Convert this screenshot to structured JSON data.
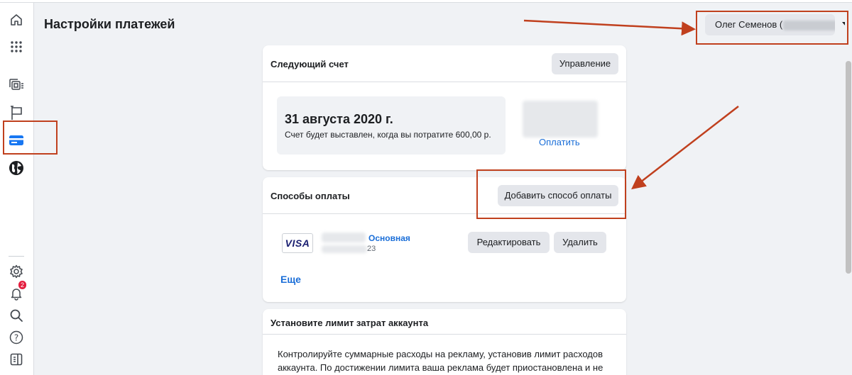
{
  "header": {
    "page_title": "Настройки платежей",
    "account_name": "Олег Семенов (",
    "account_suffix": "."
  },
  "sidebar": {
    "icons": [
      "home-icon",
      "apps-grid-icon",
      "ad-manager-icon",
      "flag-icon",
      "payment-card-icon",
      "globe-icon",
      "settings-icon",
      "bell-icon",
      "search-icon",
      "help-icon",
      "panel-toggle-icon"
    ],
    "notification_count": "2",
    "active": "payment-card-icon"
  },
  "next_bill": {
    "title": "Следующий счет",
    "manage_label": "Управление",
    "date": "31 августа 2020 г.",
    "description": "Счет будет выставлен, когда вы потратите 600,00 р.",
    "pay_label": "Оплатить"
  },
  "payment_methods": {
    "title": "Способы оплаты",
    "add_label": "Добавить способ оплаты",
    "card_brand": "VISA",
    "card_expiry_fragment": "23",
    "primary_label": "Основная",
    "edit_label": "Редактировать",
    "delete_label": "Удалить",
    "more_label": "Еще"
  },
  "spending_limit": {
    "title": "Установите лимит затрат аккаунта",
    "text": "Контролируйте суммарные расходы на рекламу, установив лимит расходов аккаунта. По достижении лимита ваша реклама будет приостановлена и не будет"
  },
  "colors": {
    "accent": "#1877f2",
    "link": "#1a6ed8",
    "annotation": "#c0401e",
    "background": "#f0f2f5"
  }
}
